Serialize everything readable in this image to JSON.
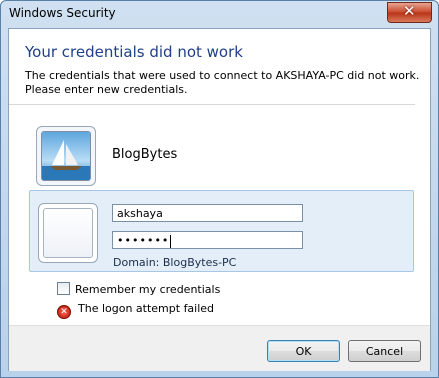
{
  "window": {
    "title": "Windows Security",
    "close_label": "✕"
  },
  "dialog": {
    "heading": "Your credentials did not work",
    "message_line1": "The credentials that were used to connect to AKSHAYA-PC did not work.",
    "message_line2": "Please enter new credentials."
  },
  "saved_user": {
    "name": "BlogBytes",
    "icon": "sailboat-user-icon"
  },
  "credentials": {
    "username": "akshaya",
    "password_mask": "•••••••",
    "domain_label": "Domain: BlogBytes-PC",
    "icon": "blank-user-tile-icon"
  },
  "remember": {
    "label": "Remember my credentials",
    "checked": false
  },
  "error": {
    "text": "The logon attempt failed",
    "icon": "error-icon"
  },
  "buttons": {
    "ok": "OK",
    "cancel": "Cancel"
  },
  "colors": {
    "heading": "#1f3f8a",
    "panel": "#e4eef9",
    "close": "#c8472b"
  }
}
